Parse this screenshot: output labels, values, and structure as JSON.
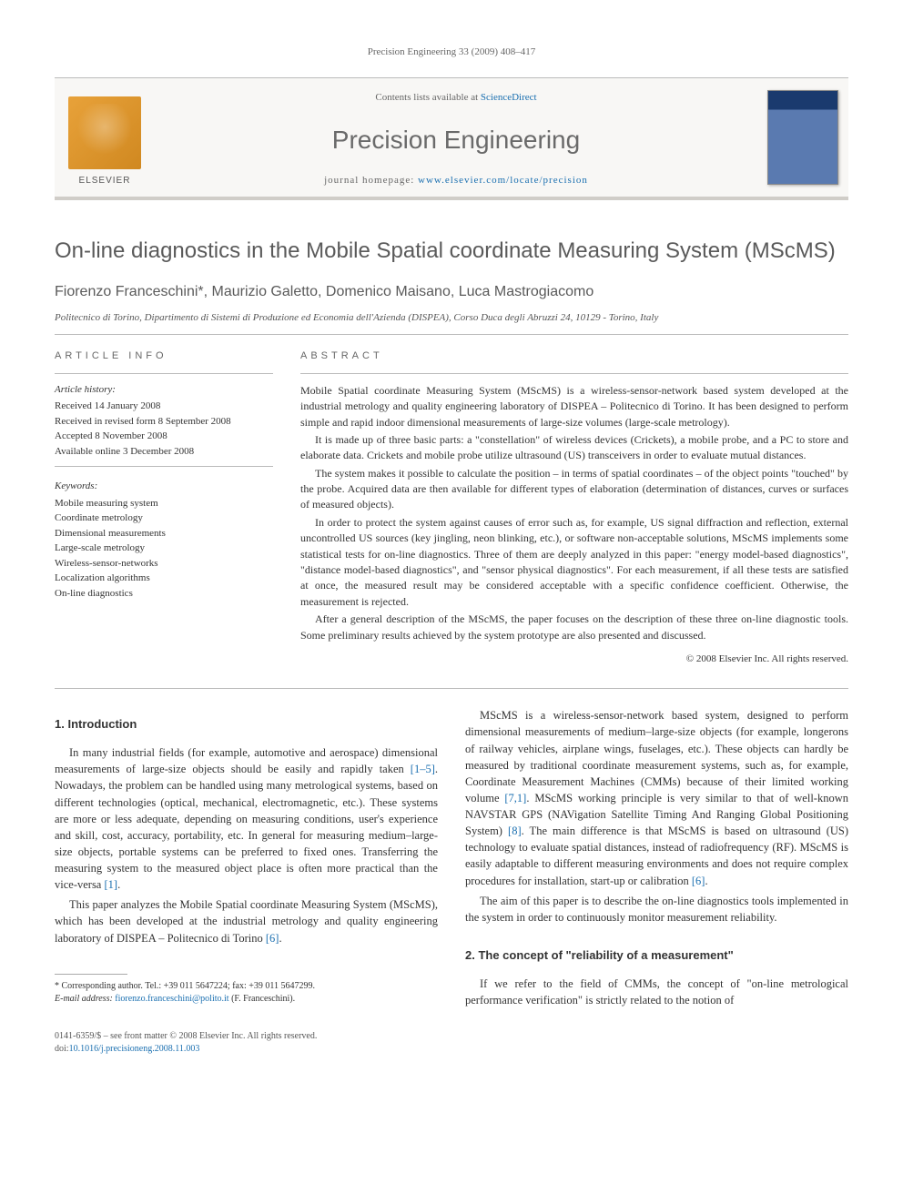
{
  "running_head": "Precision Engineering 33 (2009) 408–417",
  "masthead": {
    "contents_prefix": "Contents lists available at ",
    "contents_link": "ScienceDirect",
    "journal": "Precision Engineering",
    "homepage_prefix": "journal homepage: ",
    "homepage_url": "www.elsevier.com/locate/precision",
    "publisher": "ELSEVIER"
  },
  "title": "On-line diagnostics in the Mobile Spatial coordinate Measuring System (MScMS)",
  "authors": "Fiorenzo Franceschini*, Maurizio Galetto, Domenico Maisano, Luca Mastrogiacomo",
  "affiliation": "Politecnico di Torino, Dipartimento di Sistemi di Produzione ed Economia dell'Azienda (DISPEA), Corso Duca degli Abruzzi 24, 10129 - Torino, Italy",
  "info": {
    "label": "article info",
    "history_label": "Article history:",
    "history": [
      "Received 14 January 2008",
      "Received in revised form 8 September 2008",
      "Accepted 8 November 2008",
      "Available online 3 December 2008"
    ],
    "keywords_label": "Keywords:",
    "keywords": [
      "Mobile measuring system",
      "Coordinate metrology",
      "Dimensional measurements",
      "Large-scale metrology",
      "Wireless-sensor-networks",
      "Localization algorithms",
      "On-line diagnostics"
    ]
  },
  "abstract": {
    "label": "abstract",
    "paragraphs": [
      "Mobile Spatial coordinate Measuring System (MScMS) is a wireless-sensor-network based system developed at the industrial metrology and quality engineering laboratory of DISPEA – Politecnico di Torino. It has been designed to perform simple and rapid indoor dimensional measurements of large-size volumes (large-scale metrology).",
      "It is made up of three basic parts: a \"constellation\" of wireless devices (Crickets), a mobile probe, and a PC to store and elaborate data. Crickets and mobile probe utilize ultrasound (US) transceivers in order to evaluate mutual distances.",
      "The system makes it possible to calculate the position – in terms of spatial coordinates – of the object points \"touched\" by the probe. Acquired data are then available for different types of elaboration (determination of distances, curves or surfaces of measured objects).",
      "In order to protect the system against causes of error such as, for example, US signal diffraction and reflection, external uncontrolled US sources (key jingling, neon blinking, etc.), or software non-acceptable solutions, MScMS implements some statistical tests for on-line diagnostics. Three of them are deeply analyzed in this paper: \"energy model-based diagnostics\", \"distance model-based diagnostics\", and \"sensor physical diagnostics\". For each measurement, if all these tests are satisfied at once, the measured result may be considered acceptable with a specific confidence coefficient. Otherwise, the measurement is rejected.",
      "After a general description of the MScMS, the paper focuses on the description of these three on-line diagnostic tools. Some preliminary results achieved by the system prototype are also presented and discussed."
    ],
    "copyright": "© 2008 Elsevier Inc. All rights reserved."
  },
  "body": {
    "s1_heading": "1.  Introduction",
    "s1_p1_a": "In many industrial fields (for example, automotive and aerospace) dimensional measurements of large-size objects should be easily and rapidly taken ",
    "s1_p1_ref1": "[1–5]",
    "s1_p1_b": ". Nowadays, the problem can be handled using many metrological systems, based on different technologies (optical, mechanical, electromagnetic, etc.). These systems are more or less adequate, depending on measuring conditions, user's experience and skill, cost, accuracy, portability, etc. In general for measuring medium–large-size objects, portable systems can be preferred to fixed ones. Transferring the measuring system to the measured object place is often more practical than the vice-versa ",
    "s1_p1_ref2": "[1]",
    "s1_p1_c": ".",
    "s1_p2_a": "This paper analyzes the Mobile Spatial coordinate Measuring System (MScMS), which has been developed at the industrial metrology and quality engineering laboratory of DISPEA – Politecnico di Torino ",
    "s1_p2_ref": "[6]",
    "s1_p2_b": ".",
    "s1_p3_a": "MScMS is a wireless-sensor-network based system, designed to perform dimensional measurements of medium–large-size objects (for example, longerons of railway vehicles, airplane wings, fuselages, etc.). These objects can hardly be measured by traditional coordinate measurement systems, such as, for example, Coordinate Measurement Machines (CMMs) because of their limited working volume ",
    "s1_p3_ref1": "[7,1]",
    "s1_p3_b": ". MScMS working principle is very similar to that of well-known NAVSTAR GPS (NAVigation Satellite Timing And Ranging Global Positioning System) ",
    "s1_p3_ref2": "[8]",
    "s1_p3_c": ". The main difference is that MScMS is based on ultrasound (US) technology to evaluate spatial distances, instead of radiofrequency (RF). MScMS is easily adaptable to different measuring environments and does not require complex procedures for installation, start-up or calibration ",
    "s1_p3_ref3": "[6]",
    "s1_p3_d": ".",
    "s1_p4": "The aim of this paper is to describe the on-line diagnostics tools implemented in the system in order to continuously monitor measurement reliability.",
    "s2_heading": "2.  The concept of \"reliability of a measurement\"",
    "s2_p1": "If we refer to the field of CMMs, the concept of \"on-line metrological performance verification\" is strictly related to the notion of"
  },
  "footnote": {
    "line1": "* Corresponding author. Tel.: +39 011 5647224; fax: +39 011 5647299.",
    "line2_label": "E-mail address: ",
    "line2_email": "fiorenzo.franceschini@polito.it",
    "line2_suffix": " (F. Franceschini)."
  },
  "bottom": {
    "line1": "0141-6359/$ – see front matter © 2008 Elsevier Inc. All rights reserved.",
    "doi_prefix": "doi:",
    "doi": "10.1016/j.precisioneng.2008.11.003"
  }
}
